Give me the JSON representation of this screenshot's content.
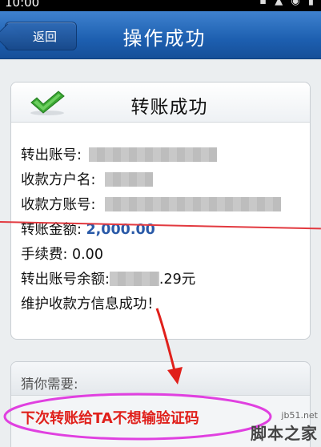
{
  "status_bar": {
    "time": "10:00",
    "icons": "▪ ▲ ◉ ▮"
  },
  "nav": {
    "back_label": "返回",
    "title": "操作成功"
  },
  "result": {
    "title": "转账成功",
    "rows": [
      {
        "label": "转出账号:",
        "value": ""
      },
      {
        "label": "收款方户名:",
        "value": ""
      },
      {
        "label": "收款方账号:",
        "value": ""
      },
      {
        "label": "转账金额:",
        "value": "2,000.00"
      },
      {
        "label": "手续费:",
        "value": "0.00"
      },
      {
        "label": "转出账号余额:",
        "value": ".29元"
      },
      {
        "label": "维护收款方信息成功！",
        "value": ""
      }
    ]
  },
  "guess": {
    "title": "猜你需要:",
    "item": "下次转账给TA不想输验证码"
  },
  "watermark": {
    "site": "jb51.net",
    "name": "脚本之家"
  },
  "colors": {
    "nav": "#1d5fb0",
    "amount": "#2a5aa8",
    "annotation": "#e0201b",
    "highlight": "#e040e0",
    "check": "#3aa632"
  }
}
